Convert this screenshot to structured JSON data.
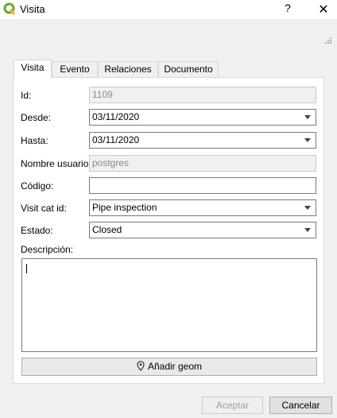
{
  "window": {
    "title": "Visita",
    "help_label": "?",
    "close_label": "✕"
  },
  "tabs": [
    {
      "label": "Visita",
      "active": true
    },
    {
      "label": "Evento",
      "active": false
    },
    {
      "label": "Relaciones",
      "active": false
    },
    {
      "label": "Documento",
      "active": false
    }
  ],
  "form": {
    "id": {
      "label": "Id:",
      "value": "1109"
    },
    "desde": {
      "label": "Desde:",
      "value": "03/11/2020"
    },
    "hasta": {
      "label": "Hasta:",
      "value": "03/11/2020"
    },
    "user": {
      "label": "Nombre usuario:",
      "value": "postgres"
    },
    "codigo": {
      "label": "Código:",
      "value": ""
    },
    "visit_cat": {
      "label": "Visit cat id:",
      "value": "Pipe inspection"
    },
    "estado": {
      "label": "Estado:",
      "value": "Closed"
    },
    "descripcion": {
      "label": "Descripción:",
      "value": ""
    },
    "geom_button": "Añadir geom"
  },
  "buttons": {
    "accept": "Aceptar",
    "cancel": "Cancelar"
  },
  "colors": {
    "brand_green": "#6aa42b",
    "background": "#f0f0f0"
  }
}
